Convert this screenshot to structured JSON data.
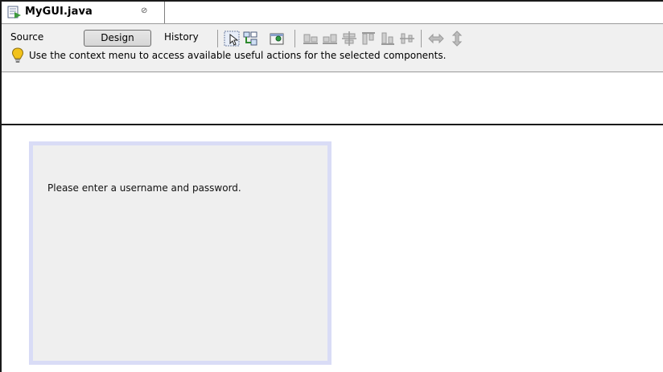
{
  "tab": {
    "title": "MyGUI.java",
    "close_glyph": "⊘",
    "icon": "java-file-icon"
  },
  "toolbar": {
    "source_label": "Source",
    "design_label": "Design",
    "history_label": "History",
    "selected_view": "Design",
    "tools": [
      {
        "icon": "selection-mode-icon",
        "enabled": true
      },
      {
        "icon": "connection-mode-icon",
        "enabled": true
      },
      {
        "icon": "preview-design-icon",
        "enabled": true
      },
      {
        "icon": "align-left-icon",
        "enabled": false
      },
      {
        "icon": "align-right-icon",
        "enabled": false
      },
      {
        "icon": "center-horizontally-icon",
        "enabled": false
      },
      {
        "icon": "align-top-icon",
        "enabled": false
      },
      {
        "icon": "align-bottom-icon",
        "enabled": false
      },
      {
        "icon": "center-vertically-icon",
        "enabled": false
      },
      {
        "icon": "horizontal-resize-icon",
        "enabled": false
      },
      {
        "icon": "vertical-resize-icon",
        "enabled": false
      }
    ]
  },
  "hint": {
    "icon": "lightbulb-icon",
    "text": "Use the context menu to access available useful actions for the selected components."
  },
  "form": {
    "label_text": "Please enter a username and password."
  },
  "colors": {
    "panel_border": "#d9dcf6",
    "panel_bg": "#efefef",
    "bulb": "#f2c21b"
  }
}
